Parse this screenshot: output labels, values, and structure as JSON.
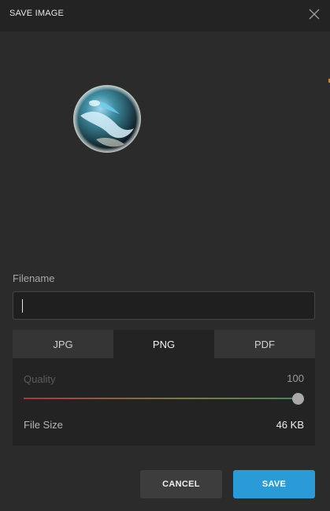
{
  "dialog": {
    "title": "SAVE IMAGE",
    "close_icon": "close-icon"
  },
  "preview": {
    "image": "marble-image"
  },
  "filename": {
    "label": "Filename",
    "value": "",
    "placeholder": ""
  },
  "format_tabs": [
    {
      "label": "JPG",
      "active": false
    },
    {
      "label": "PNG",
      "active": true
    },
    {
      "label": "PDF",
      "active": false
    }
  ],
  "quality": {
    "label": "Quality",
    "value": "100",
    "level_fraction": 1.0
  },
  "file_size": {
    "label": "File Size",
    "value": "46 KB"
  },
  "buttons": {
    "cancel": "CANCEL",
    "save": "SAVE"
  },
  "colors": {
    "accent": "#2a9bd6",
    "background": "#2b2b2b",
    "header": "#232323"
  }
}
